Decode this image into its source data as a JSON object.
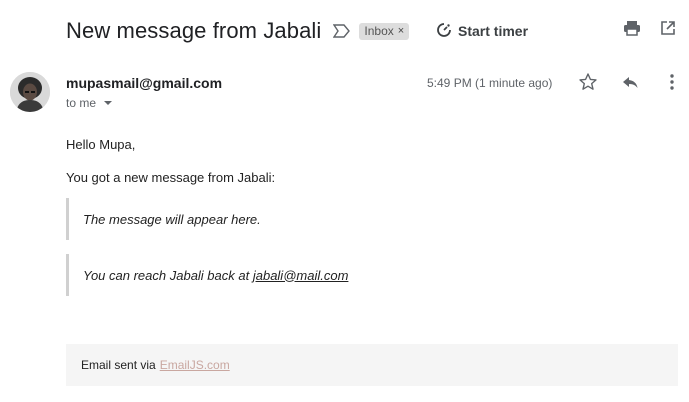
{
  "subject": "New message from Jabali",
  "label": {
    "name": "Inbox",
    "remove": "×"
  },
  "timer": {
    "label": "Start timer"
  },
  "sender": {
    "email": "mupasmail@gmail.com",
    "to": "to me"
  },
  "time": "5:49 PM (1 minute ago)",
  "body": {
    "greeting": "Hello Mupa,",
    "intro": "You got a new message from Jabali:",
    "message": "The message will appear here.",
    "reach_prefix": "You can reach Jabali back at ",
    "reach_email": "jabali@mail.com"
  },
  "footer": {
    "prefix": "Email sent via",
    "link": "EmailJS.com"
  },
  "icons": {
    "important": "important-marker-icon",
    "timer": "timer-icon",
    "print": "print-icon",
    "open_new": "open-in-new-window-icon",
    "star": "star-icon",
    "reply": "reply-icon",
    "more": "more-vertical-icon"
  },
  "colors": {
    "chip_bg": "#dddddd",
    "footer_bg": "#f5f5f5",
    "link_footer": "#c9a7a0",
    "quote_bar": "#d0d0d0"
  }
}
